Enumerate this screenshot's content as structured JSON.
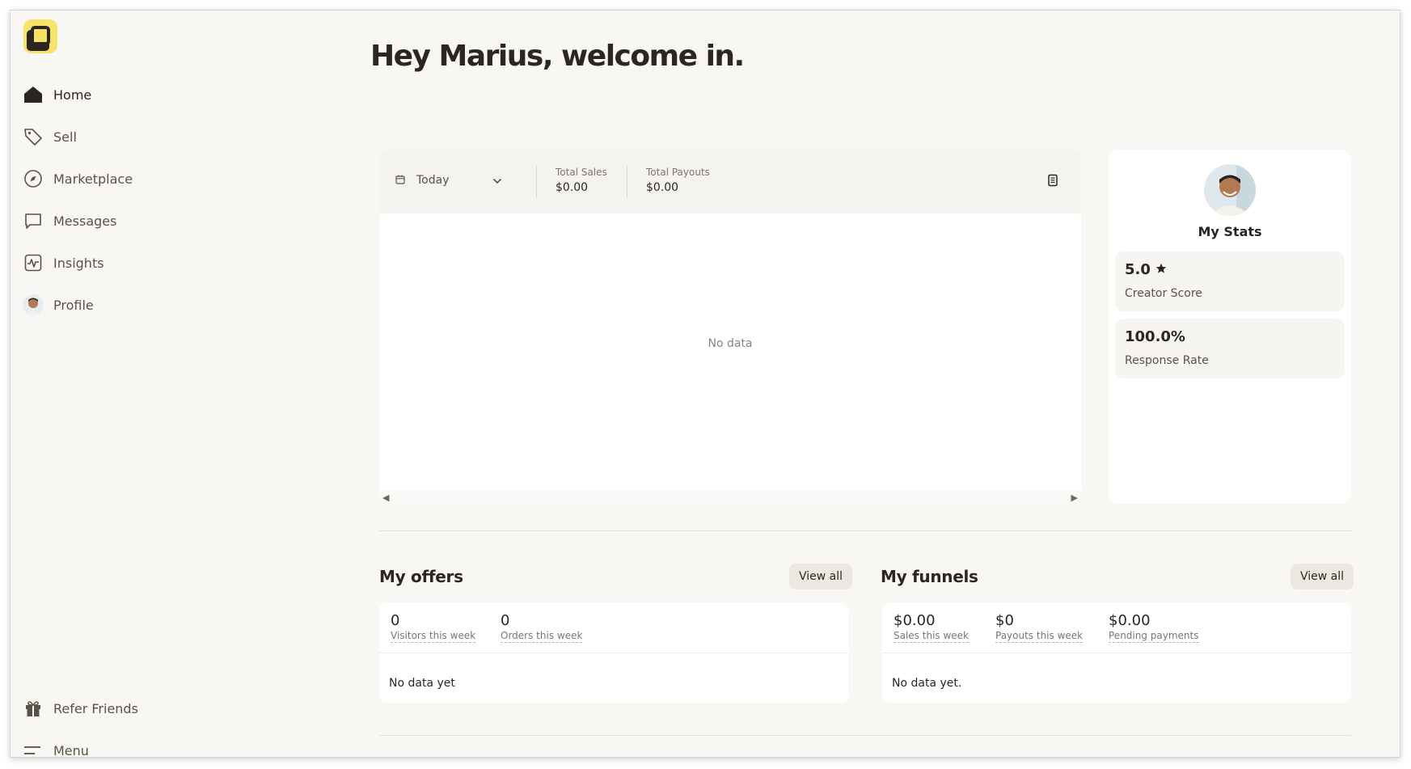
{
  "header": {
    "title": "Hey Marius, welcome in."
  },
  "sidebar": {
    "items": [
      {
        "label": "Home",
        "icon": "home-icon"
      },
      {
        "label": "Sell",
        "icon": "tag-icon"
      },
      {
        "label": "Marketplace",
        "icon": "compass-icon"
      },
      {
        "label": "Messages",
        "icon": "message-icon"
      },
      {
        "label": "Insights",
        "icon": "chart-icon"
      },
      {
        "label": "Profile",
        "icon": "avatar"
      }
    ],
    "bottom": [
      {
        "label": "Refer Friends",
        "icon": "gift-icon"
      },
      {
        "label": "Menu",
        "icon": "menu-icon"
      }
    ]
  },
  "chart": {
    "range": "Today",
    "total_sales_label": "Total Sales",
    "total_sales_value": "$0.00",
    "total_payouts_label": "Total Payouts",
    "total_payouts_value": "$0.00",
    "empty": "No data"
  },
  "stats": {
    "title": "My Stats",
    "creator_score_value": "5.0",
    "creator_score_label": "Creator Score",
    "response_rate_value": "100.0%",
    "response_rate_label": "Response Rate"
  },
  "offers": {
    "title": "My offers",
    "view_all": "View all",
    "visitors_value": "0",
    "visitors_label": "Visitors this week",
    "orders_value": "0",
    "orders_label": "Orders this week",
    "empty": "No data yet"
  },
  "funnels": {
    "title": "My funnels",
    "view_all": "View all",
    "sales_value": "$0.00",
    "sales_label": "Sales this week",
    "payouts_value": "$0",
    "payouts_label": "Payouts this week",
    "pending_value": "$0.00",
    "pending_label": "Pending payments",
    "empty": "No data yet."
  },
  "colors": {
    "accent": "#f6e36a",
    "text": "#2b2620",
    "background": "#f9f7f3"
  }
}
